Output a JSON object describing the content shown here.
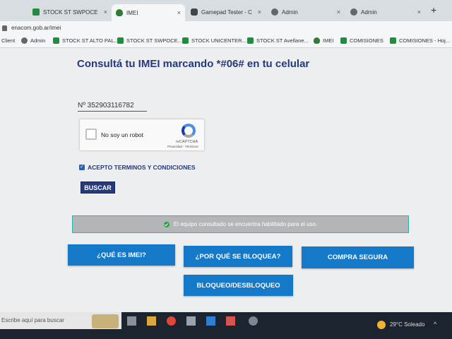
{
  "browser": {
    "tabs": [
      {
        "label": "STOCK ST SWPOCENT",
        "icon": "sheet"
      },
      {
        "label": "IMEI",
        "icon": "flame"
      },
      {
        "label": "Gamepad Tester - Che",
        "icon": "gamepad"
      },
      {
        "label": "Admin",
        "icon": "globe"
      },
      {
        "label": "Admin",
        "icon": "globe"
      }
    ],
    "tab_close": "×",
    "new_tab": "+",
    "url": "enacom.gob.ar/imei",
    "bookmarks": [
      {
        "label": "Client"
      },
      {
        "label": "Admin",
        "icon": "globe"
      },
      {
        "label": "STOCK ST ALTO PAL...",
        "icon": "sheet"
      },
      {
        "label": "STOCK ST SWPOCE...",
        "icon": "sheet"
      },
      {
        "label": "STOCK UNICENTER...",
        "icon": "sheet"
      },
      {
        "label": "STOCK ST Avellane...",
        "icon": "sheet"
      },
      {
        "label": "IMEI",
        "icon": "flame"
      },
      {
        "label": "COMISIONES",
        "icon": "sheet"
      },
      {
        "label": "COMISIONES - Hoj...",
        "icon": "sheet"
      }
    ]
  },
  "page": {
    "heading": "Consultá tu IMEI marcando *#06# en tu celular",
    "imei_value": "Nº  352903116782",
    "captcha": {
      "label": "No soy un robot",
      "brand": "reCAPTCHA",
      "links": "Privacidad - Términos"
    },
    "terms_label": "ACEPTO TERMINOS Y CONDICIONES",
    "terms_checked": true,
    "search_button": "BUSCAR",
    "result_text": "El equipo consultado se encuentra habilitado para el uso.",
    "buttons": {
      "what_is_imei": "¿QUÉ ES IMEI?",
      "why_blocked": "¿POR QUÉ SE BLOQUEA?",
      "safe_purchase": "COMPRA SEGURA",
      "block_unblock": "BLOQUEO/DESBLOQUEO"
    }
  },
  "taskbar": {
    "search_placeholder": "Escribe aquí para buscar",
    "weather": "29°C  Soleado",
    "tray_caret": "^"
  },
  "colors": {
    "heading": "#243a7a",
    "primary_button": "#1479c9",
    "search_button": "#243a7a",
    "result_bg": "#b3b6b9",
    "ok": "#2f9e44"
  }
}
